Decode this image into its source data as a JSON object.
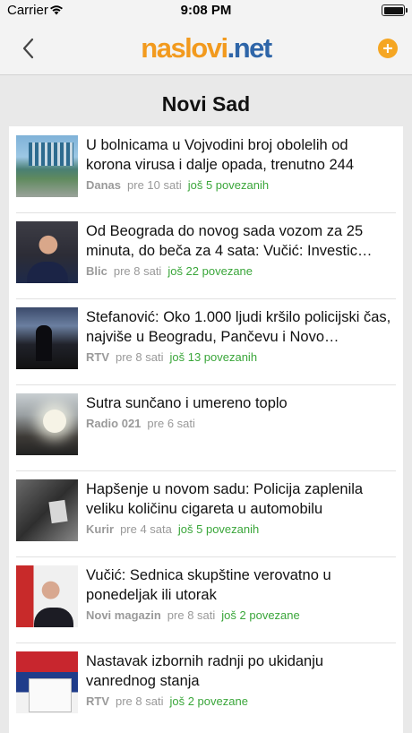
{
  "status_bar": {
    "carrier": "Carrier",
    "time": "9:08 PM"
  },
  "nav": {
    "logo_part1": "naslovi",
    "logo_part2": ".net",
    "back_icon": "chevron-left-icon",
    "add_icon": "plus-circle-icon",
    "accent_color": "#f5a623"
  },
  "page": {
    "title": "Novi Sad"
  },
  "colors": {
    "related_link": "#3aa63a",
    "meta_gray": "#999999",
    "logo_orange": "#f29a1e",
    "logo_blue": "#2e65a8"
  },
  "articles": [
    {
      "headline": "U bolnicama u Vojvodini broj obolelih od korona virusa i dalje opada, trenutno 244",
      "source": "Danas",
      "time": "pre 10 sati",
      "related": "još 5 povezanih"
    },
    {
      "headline": "Od Beograda do novog sada vozom za 25 minuta, do beča za 4 sata: Vučić: Investic…",
      "source": "Blic",
      "time": "pre 8 sati",
      "related": "još 22 povezane"
    },
    {
      "headline": "Stefanović: Oko 1.000 ljudi kršilo policijski čas, najviše u Beogradu, Pančevu i Novo…",
      "source": "RTV",
      "time": "pre 8 sati",
      "related": "još 13 povezanih"
    },
    {
      "headline": "Sutra sunčano i umereno toplo",
      "source": "Radio 021",
      "time": "pre 6 sati",
      "related": ""
    },
    {
      "headline": "Hapšenje u novom sadu: Policija zaplenila veliku količinu cigareta u automobilu",
      "source": "Kurir",
      "time": "pre 4 sata",
      "related": "još 5 povezanih"
    },
    {
      "headline": "Vučić: Sednica skupštine verovatno u ponedeljak ili utorak",
      "source": "Novi magazin",
      "time": "pre 8 sati",
      "related": "još 2 povezane"
    },
    {
      "headline": "Nastavak izbornih radnji po ukidanju vanrednog stanja",
      "source": "RTV",
      "time": "pre 8 sati",
      "related": "još 2 povezane"
    }
  ]
}
